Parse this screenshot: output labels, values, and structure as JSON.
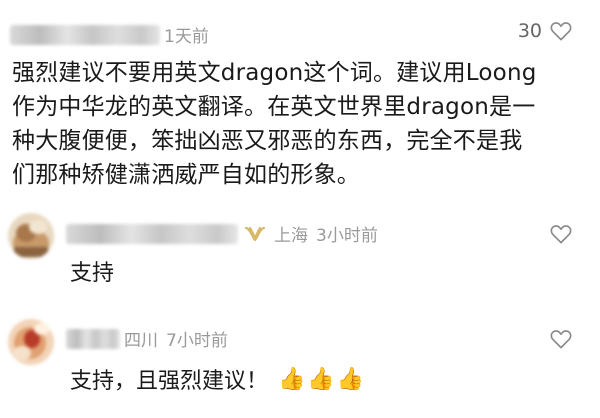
{
  "main_comment": {
    "time": "1天前",
    "like_count": "30",
    "lines": [
      "强烈建议不要用英文dragon这个词。建议用Loong",
      "作为中华龙的英文翻译。在英文世界里dragon是一",
      "种大腹便便，笨拙凶恶又邪恶的东西，完全不是我",
      "们那种矫健潇洒威严自如的形象。"
    ]
  },
  "reply_1": {
    "location": "上海",
    "time": "3小时前",
    "text": "支持"
  },
  "reply_2": {
    "location": "四川",
    "time": "7小时前",
    "text": "支持，且强烈建议！",
    "emoji": [
      "👍",
      "👍",
      "👍"
    ]
  },
  "icons": {
    "heart": "heart-outline-icon",
    "badge": "vip-badge-icon"
  },
  "colors": {
    "meta_gray": "#9a9a9a",
    "badge_gold": "#d8b86a"
  }
}
